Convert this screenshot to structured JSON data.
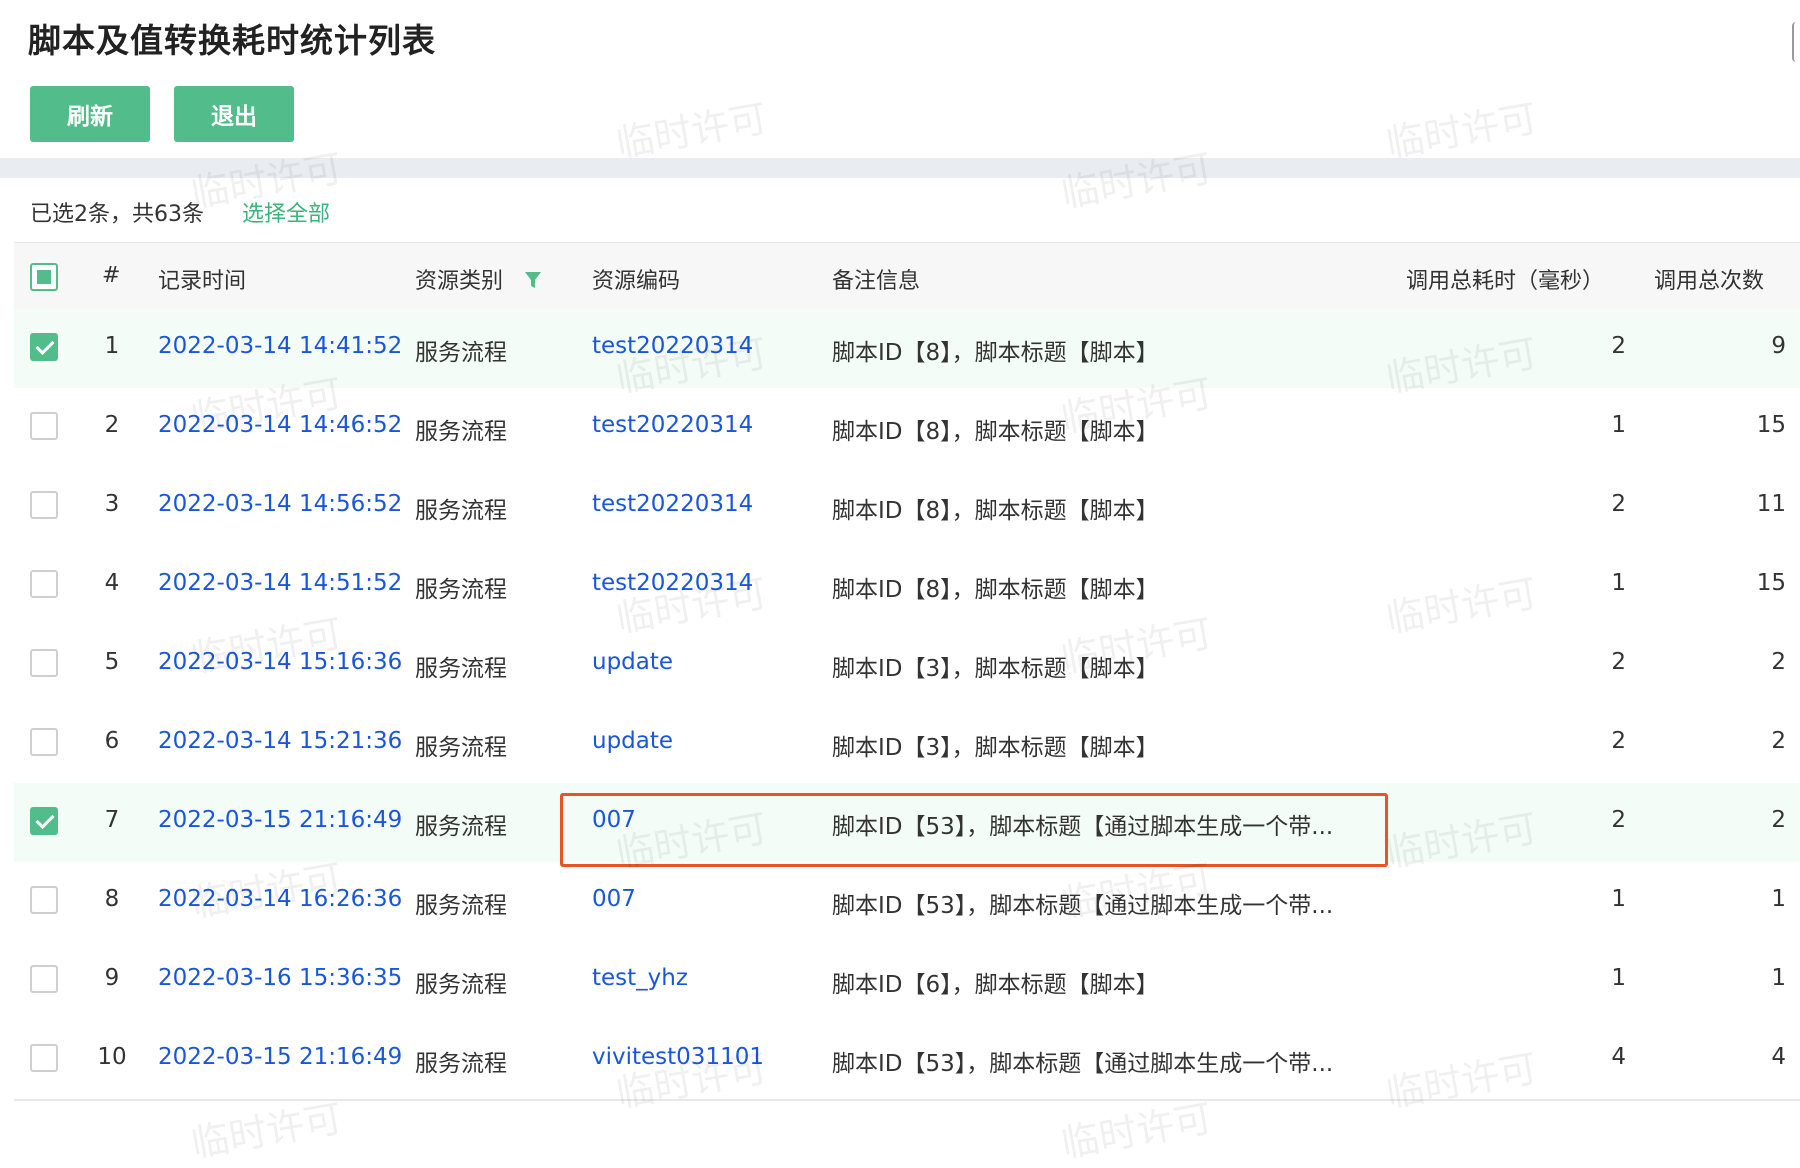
{
  "header": {
    "title": "脚本及值转换耗时统计列表"
  },
  "toolbar": {
    "refresh_label": "刷新",
    "exit_label": "退出"
  },
  "selection": {
    "summary": "已选2条，共63条",
    "select_all_label": "选择全部"
  },
  "watermark": {
    "text": "临时许可"
  },
  "columns": {
    "index": "#",
    "record_time": "记录时间",
    "resource_type": "资源类别",
    "resource_code": "资源编码",
    "remark": "备注信息",
    "duration": "调用总耗时（毫秒）",
    "count": "调用总次数"
  },
  "colors": {
    "accent": "#52bd8a",
    "link": "#1a56db",
    "highlight": "#e8532a"
  },
  "rows": [
    {
      "no": "1",
      "time": "2022-03-14 14:41:52",
      "type": "服务流程",
      "code": "test20220314",
      "note": "脚本ID【8】，脚本标题【脚本】",
      "duration": "2",
      "count": "9",
      "checked": true
    },
    {
      "no": "2",
      "time": "2022-03-14 14:46:52",
      "type": "服务流程",
      "code": "test20220314",
      "note": "脚本ID【8】，脚本标题【脚本】",
      "duration": "1",
      "count": "15",
      "checked": false
    },
    {
      "no": "3",
      "time": "2022-03-14 14:56:52",
      "type": "服务流程",
      "code": "test20220314",
      "note": "脚本ID【8】，脚本标题【脚本】",
      "duration": "2",
      "count": "11",
      "checked": false
    },
    {
      "no": "4",
      "time": "2022-03-14 14:51:52",
      "type": "服务流程",
      "code": "test20220314",
      "note": "脚本ID【8】，脚本标题【脚本】",
      "duration": "1",
      "count": "15",
      "checked": false
    },
    {
      "no": "5",
      "time": "2022-03-14 15:16:36",
      "type": "服务流程",
      "code": "update",
      "note": "脚本ID【3】，脚本标题【脚本】",
      "duration": "2",
      "count": "2",
      "checked": false
    },
    {
      "no": "6",
      "time": "2022-03-14 15:21:36",
      "type": "服务流程",
      "code": "update",
      "note": "脚本ID【3】，脚本标题【脚本】",
      "duration": "2",
      "count": "2",
      "checked": false
    },
    {
      "no": "7",
      "time": "2022-03-15 21:16:49",
      "type": "服务流程",
      "code": "007",
      "note": "脚本ID【53】，脚本标题【通过脚本生成一个带...",
      "duration": "2",
      "count": "2",
      "checked": true
    },
    {
      "no": "8",
      "time": "2022-03-14 16:26:36",
      "type": "服务流程",
      "code": "007",
      "note": "脚本ID【53】，脚本标题【通过脚本生成一个带...",
      "duration": "1",
      "count": "1",
      "checked": false
    },
    {
      "no": "9",
      "time": "2022-03-16 15:36:35",
      "type": "服务流程",
      "code": "test_yhz",
      "note": "脚本ID【6】，脚本标题【脚本】",
      "duration": "1",
      "count": "1",
      "checked": false
    },
    {
      "no": "10",
      "time": "2022-03-15 21:16:49",
      "type": "服务流程",
      "code": "vivitest031101",
      "note": "脚本ID【53】，脚本标题【通过脚本生成一个带...",
      "duration": "4",
      "count": "4",
      "checked": false
    }
  ]
}
